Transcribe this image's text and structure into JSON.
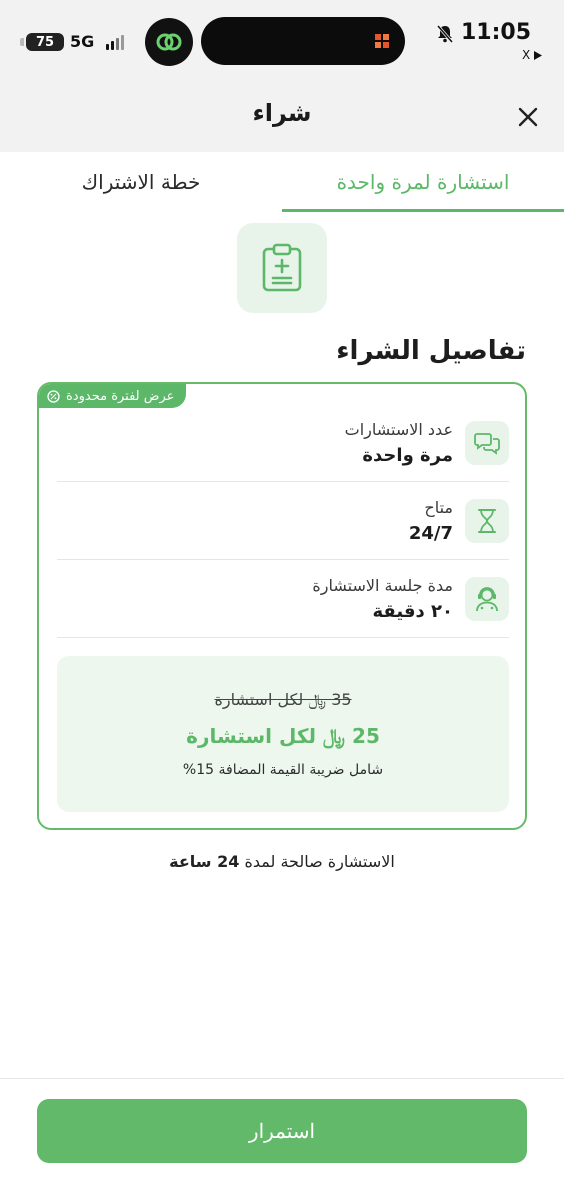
{
  "status_bar": {
    "battery": "75",
    "network": "5G",
    "time": "11:05",
    "back_app": "X"
  },
  "header": {
    "title": "شراء",
    "close_icon": "close-icon"
  },
  "tabs": [
    {
      "label": "استشارة لمرة واحدة",
      "active": true
    },
    {
      "label": "خطة الاشتراك",
      "active": false
    }
  ],
  "section_title": "تفاصيل الشراء",
  "card": {
    "badge": "عرض لفترة محدودة",
    "rows": [
      {
        "label": "عدد الاستشارات",
        "value": "مرة واحدة",
        "icon": "chat-bubbles-icon"
      },
      {
        "label": "متاح",
        "value": "24/7",
        "icon": "hourglass-icon"
      },
      {
        "label": "مدة جلسة الاستشارة",
        "value": "٢٠ دقيقة",
        "icon": "consultant-icon"
      }
    ],
    "old_price": "35 ﷼ لكل استشارة",
    "new_price": "25 ﷼ لكل استشارة",
    "vat_note": "شامل ضريبة القيمة المضافة 15%"
  },
  "validity": {
    "prefix": "الاستشارة صالحة لمدة",
    "duration": "24 ساعة"
  },
  "continue_label": "استمرار",
  "colors": {
    "accent": "#5cb868",
    "accent_light": "#e8f4ea",
    "price_bg": "#edf7ee"
  }
}
